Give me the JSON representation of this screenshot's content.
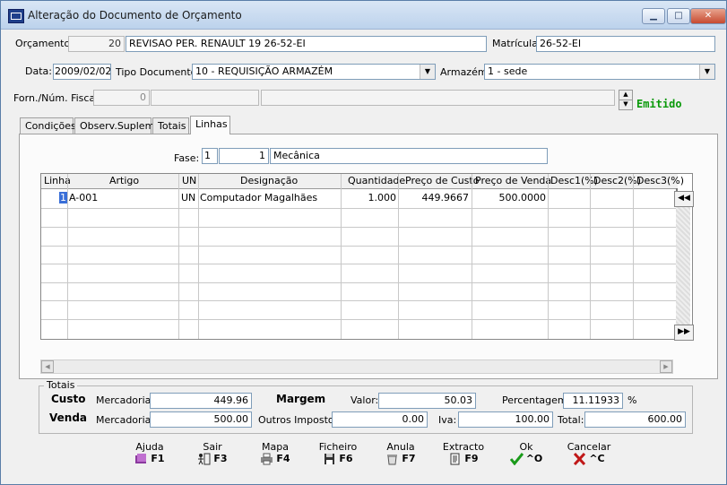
{
  "window": {
    "title": "Alteração do Documento de Orçamento",
    "min": "▁",
    "max": "□",
    "close": "✕"
  },
  "header": {
    "orcamento_label": "Orçamento:",
    "orcamento_num": "20",
    "orcamento_desc": "REVISAO PER. RENAULT 19 26-52-EI",
    "matricula_label": "Matrícula",
    "matricula_value": "26-52-EI",
    "data_label": "Data:",
    "data_value": "2009/02/02",
    "tipo_label": "Tipo Documento:",
    "tipo_value": "10 - REQUISIÇÃO ARMAZÉM",
    "armazem_label": "Armazém:",
    "armazem_value": "1 - sede",
    "forn_label": "Forn./Núm. Fiscal:",
    "forn_value": "0",
    "status": "Emitido"
  },
  "tabs": [
    "Condições",
    "Observ.Suplem.",
    "Totais",
    "Linhas"
  ],
  "fase": {
    "label": "Fase:",
    "num1": "1",
    "num2": "1",
    "desc": "Mecânica"
  },
  "grid": {
    "columns": [
      "Linha",
      "Artigo",
      "UN",
      "Designação",
      "Quantidade",
      "Preço de Custo",
      "Preço de Venda",
      "Desc1(%)",
      "Desc2(%)",
      "Desc3(%)"
    ],
    "rows": [
      {
        "linha": "1",
        "artigo": "A-001",
        "un": "UN",
        "designacao": "Computador Magalhães",
        "quantidade": "1.000",
        "preco_custo": "449.9667",
        "preco_venda": "500.0000"
      }
    ],
    "btn_top": "◀◀",
    "btn_bottom": "▶▶"
  },
  "totais": {
    "title": "Totais",
    "custo_label": "Custo",
    "venda_label": "Venda",
    "mercadoria_label": "Mercadoria:",
    "custo_mercadoria": "449.96",
    "venda_mercadoria": "500.00",
    "margem_label": "Margem",
    "valor_label": "Valor:",
    "valor": "50.03",
    "percentagem_label": "Percentagem:",
    "percentagem": "11.11933",
    "pct_sign": "%",
    "outros_label": "Outros Impostos:",
    "outros": "0.00",
    "iva_label": "Iva:",
    "iva": "100.00",
    "total_label": "Total:",
    "total": "600.00"
  },
  "toolbar": [
    {
      "label": "Ajuda",
      "key": "F1",
      "icon": "help-book-icon"
    },
    {
      "label": "Sair",
      "key": "F3",
      "icon": "exit-door-icon"
    },
    {
      "label": "Mapa",
      "key": "F4",
      "icon": "printer-icon"
    },
    {
      "label": "Ficheiro",
      "key": "F6",
      "icon": "floppy-disk-icon"
    },
    {
      "label": "Anula",
      "key": "F7",
      "icon": "trash-icon"
    },
    {
      "label": "Extracto",
      "key": "F9",
      "icon": "document-icon"
    },
    {
      "label": "Ok",
      "key": "^O",
      "icon": "check-icon"
    },
    {
      "label": "Cancelar",
      "key": "^C",
      "icon": "cross-icon"
    }
  ],
  "colors": {
    "status": "#0a9a0a",
    "ok": "#1a9a1a",
    "cancel": "#c01818"
  }
}
